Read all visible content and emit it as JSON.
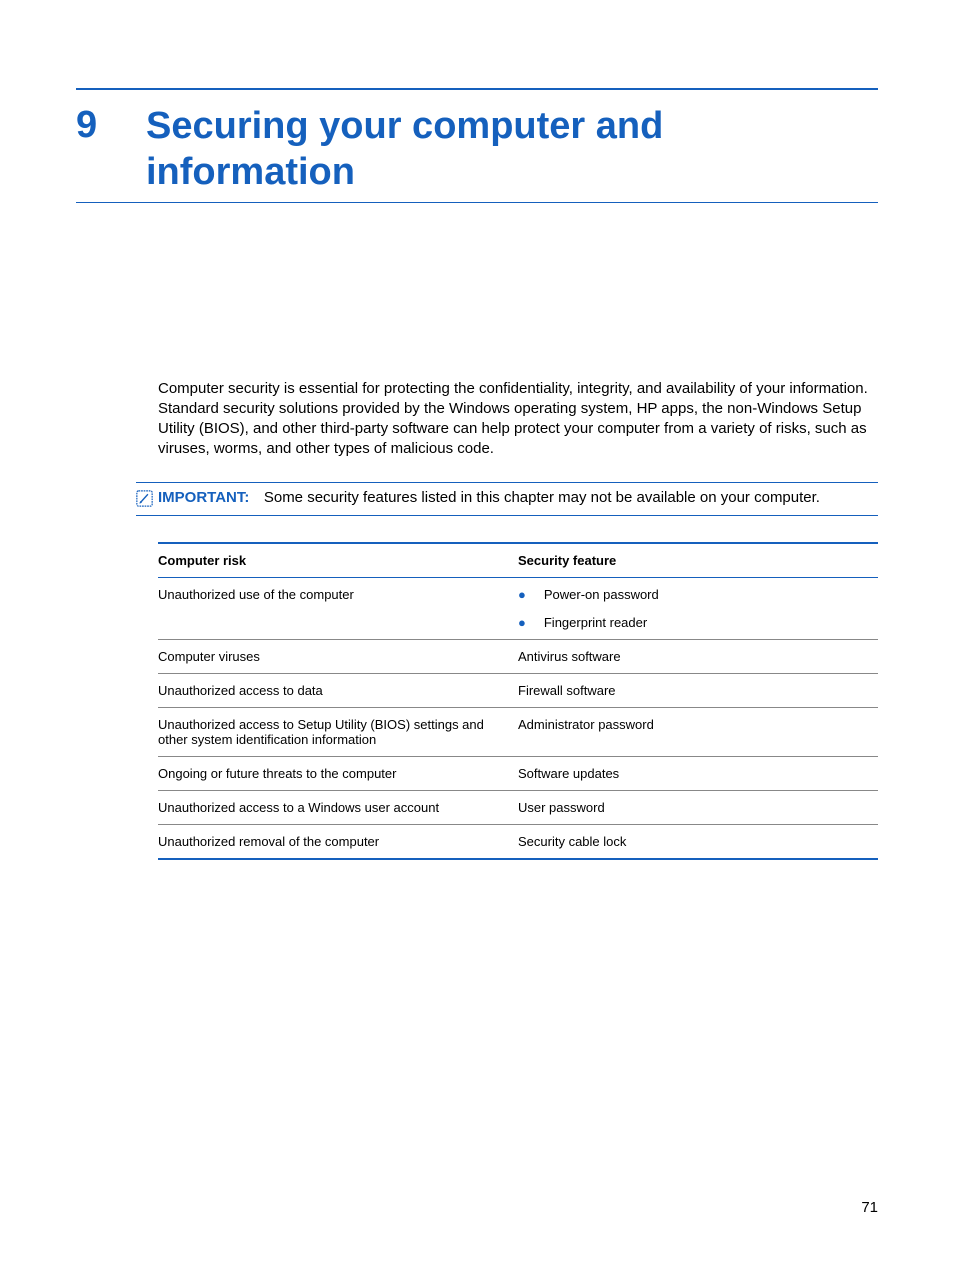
{
  "chapter": {
    "number": "9",
    "title": "Securing your computer and information"
  },
  "intro_paragraph": "Computer security is essential for protecting the confidentiality, integrity, and availability of your information. Standard security solutions provided by the Windows operating system, HP apps, the non-Windows Setup Utility (BIOS), and other third-party software can help protect your computer from a variety of risks, such as viruses, worms, and other types of malicious code.",
  "note": {
    "label": "IMPORTANT:",
    "text": "Some security features listed in this chapter may not be available on your computer."
  },
  "table": {
    "headers": {
      "col1": "Computer risk",
      "col2": "Security feature"
    },
    "rows": [
      {
        "risk": "Unauthorized use of the computer",
        "features": [
          "Power-on password",
          "Fingerprint reader"
        ]
      },
      {
        "risk": "Computer viruses",
        "features": "Antivirus software"
      },
      {
        "risk": "Unauthorized access to data",
        "features": "Firewall software"
      },
      {
        "risk": "Unauthorized access to Setup Utility (BIOS) settings and other system identification information",
        "features": "Administrator password"
      },
      {
        "risk": "Ongoing or future threats to the computer",
        "features": "Software updates"
      },
      {
        "risk": "Unauthorized access to a Windows user account",
        "features": "User password"
      },
      {
        "risk": "Unauthorized removal of the computer",
        "features": "Security cable lock"
      }
    ]
  },
  "page_number": "71"
}
